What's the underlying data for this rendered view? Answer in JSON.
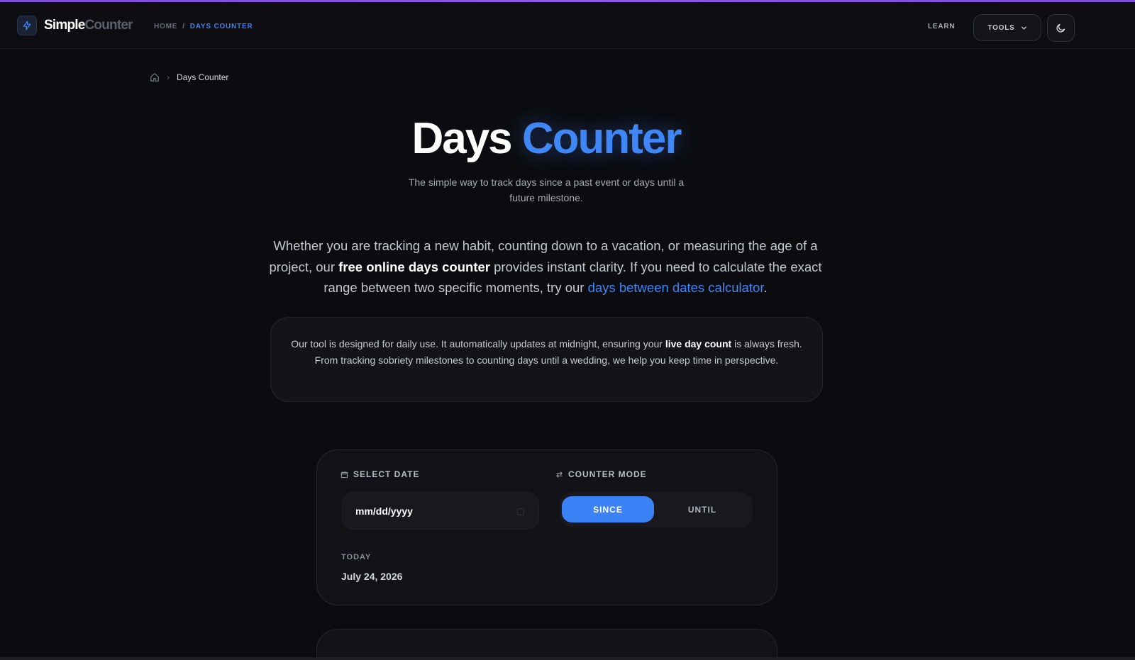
{
  "header": {
    "logo_word1": "Simple",
    "logo_word2": "Counter",
    "breadcrumb": {
      "home": "HOME",
      "separator": "/",
      "current": "DAYS COUNTER"
    },
    "nav_learn": "LEARN",
    "tools_label": "TOOLS"
  },
  "breadcrumb": {
    "current": "Days Counter"
  },
  "hero": {
    "title_part1": "Days",
    "title_part2": "Counter",
    "subtitle": "The simple way to track days since a past event or days until a future milestone."
  },
  "intro": {
    "part1": "Whether you are tracking a new habit, counting down to a vacation, or measuring the age of a project, our ",
    "bold": "free online days counter",
    "part2": " provides instant clarity. If you need to calculate the exact range between two specific moments, try our ",
    "link": "days between dates calculator",
    "part3": "."
  },
  "info": {
    "part1": "Our tool is designed for daily use. It automatically updates at midnight, ensuring your ",
    "bold": "live day count",
    "part2": " is always fresh. From tracking sobriety milestones to counting days until a wedding, we help you keep time in perspective."
  },
  "tool": {
    "select_date_label": "SELECT DATE",
    "date_placeholder": "mm/dd/yyyy",
    "counter_mode_label": "COUNTER MODE",
    "mode_since": "SINCE",
    "mode_until": "UNTIL",
    "today_label": "TODAY",
    "today_value": "July 24, 2026"
  },
  "colors": {
    "accent_blue": "#3b82f6",
    "top_bar_purple": "#8f56e6",
    "background": "#0c0c10"
  },
  "icons": {
    "logo": "lightning-icon",
    "tools_dropdown": "chevron-down-icon",
    "theme": "moon-icon",
    "home": "home-icon",
    "select_date": "calendar-icon",
    "counter_mode": "swap-arrows-icon"
  }
}
